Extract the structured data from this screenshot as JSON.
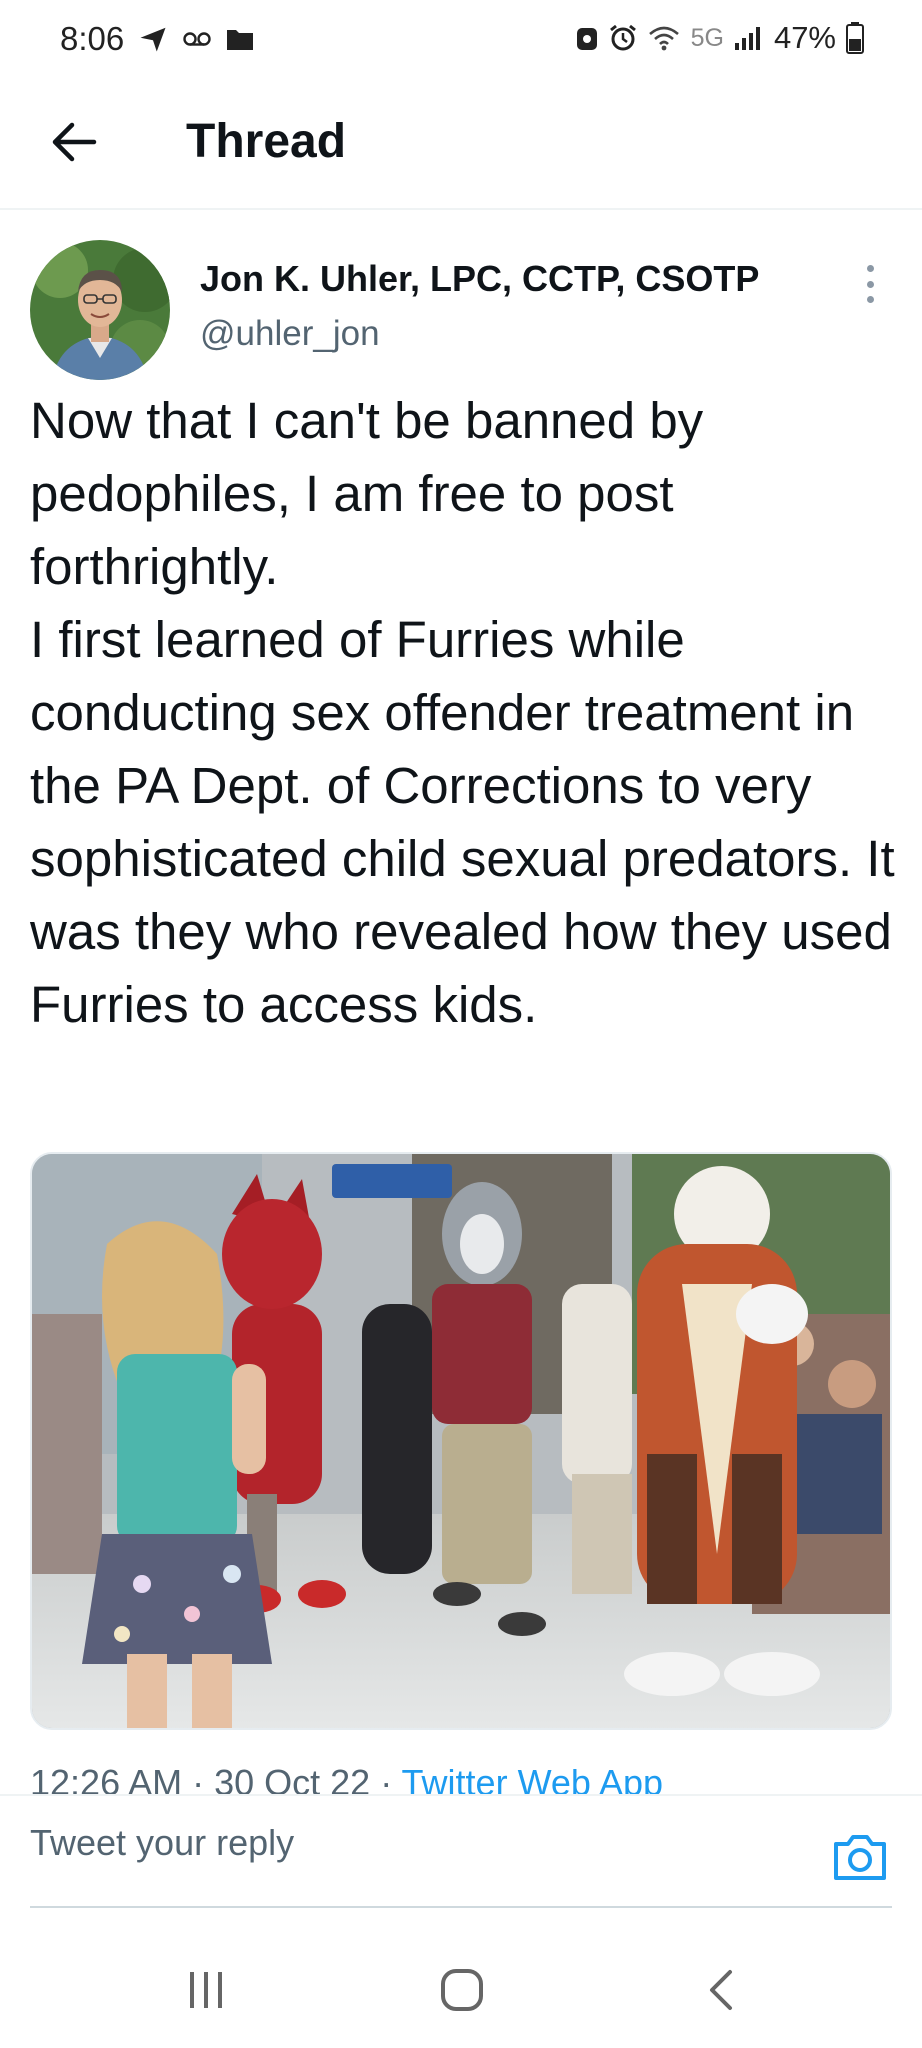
{
  "status_bar": {
    "time": "8:06",
    "network": "5G",
    "battery": "47%",
    "icons": [
      "send-icon",
      "voicemail-icon",
      "folder-icon",
      "security-icon",
      "alarm-icon",
      "wifi-icon",
      "signal-icon",
      "battery-icon"
    ]
  },
  "header": {
    "back_icon": "arrow-left-icon",
    "title": "Thread"
  },
  "tweet": {
    "author_name": "Jon K. Uhler, LPC, CCTP, CSOTP",
    "author_handle": "@uhler_jon",
    "text_paragraphs": [
      "Now that I can't be banned by pedophiles, I am free to post forthrightly.",
      "I first learned of Furries while conducting sex offender treatment in the PA Dept. of Corrections to very sophisticated child sexual predators. It was they who revealed how they used Furries to access kids."
    ],
    "time": "12:26 AM",
    "date": "30 Oct 22",
    "source": "Twitter Web App",
    "separator": " · "
  },
  "reply": {
    "placeholder": "Tweet your reply",
    "camera_icon": "camera-icon"
  },
  "navbar": {
    "icons": [
      "recent-apps-icon",
      "home-icon",
      "back-icon"
    ]
  },
  "colors": {
    "accent": "#1d9bf0",
    "text_primary": "#0f1419",
    "text_secondary": "#536471"
  }
}
